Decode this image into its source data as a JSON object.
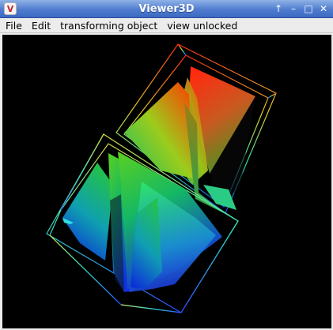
{
  "window": {
    "title": "Viewer3D",
    "app_icon_letter": "V",
    "controls": {
      "up": "↑",
      "minimize": "–",
      "maximize": "□",
      "close": "✕"
    }
  },
  "menubar": {
    "items": [
      "File",
      "Edit",
      "transforming object",
      "view unlocked"
    ]
  },
  "colors": {
    "titlebar": "#4f7ccf",
    "viewport_background": "#000000",
    "menubar": "#ececec"
  }
}
